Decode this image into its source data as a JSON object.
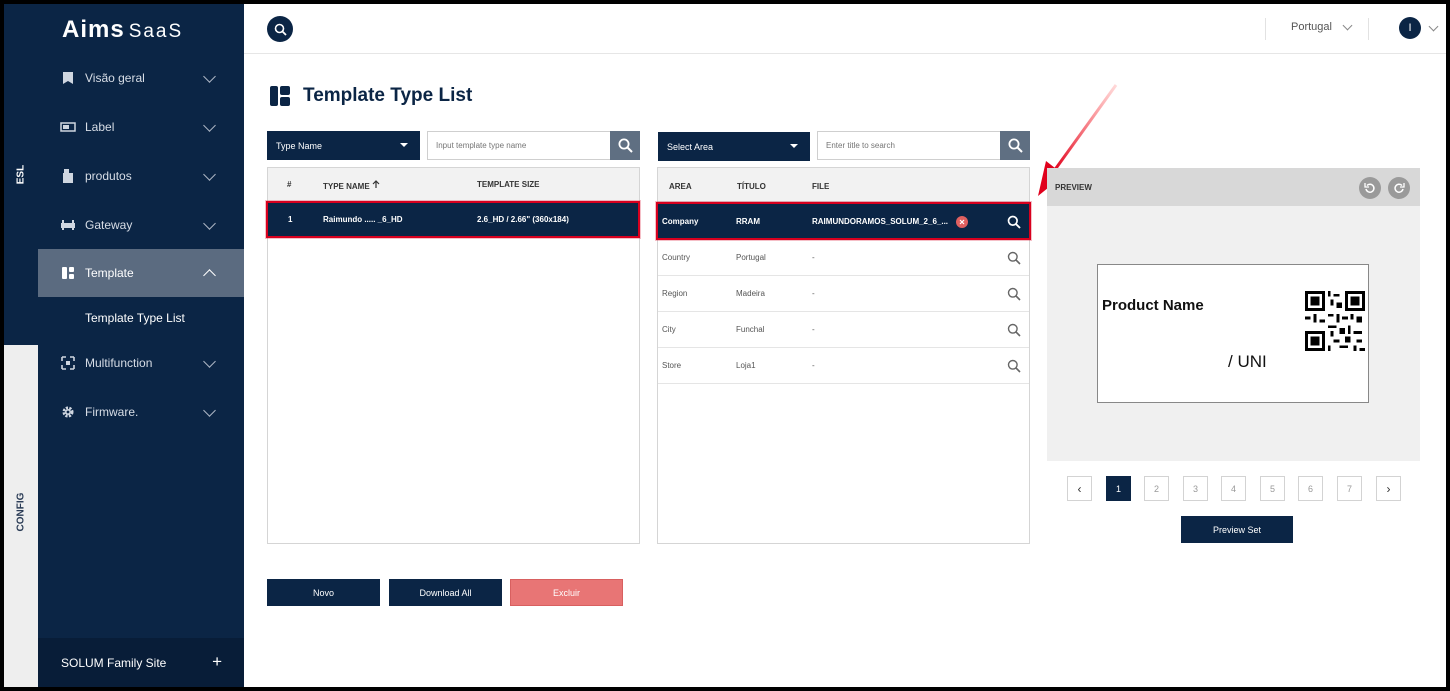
{
  "rail": {
    "esl_label": "ESL",
    "config_label": "CONFIG"
  },
  "app": {
    "logo_main": "Aims",
    "logo_sub": "SaaS"
  },
  "sidebar": {
    "items": [
      {
        "label": "Visão geral"
      },
      {
        "label": "Label"
      },
      {
        "label": "produtos"
      },
      {
        "label": "Gateway"
      },
      {
        "label": "Template"
      },
      {
        "label": "Multifunction"
      },
      {
        "label": "Firmware."
      }
    ],
    "active_sub_item": "Template Type List",
    "footer_label": "SOLUM Family Site",
    "footer_plus": "+"
  },
  "topbar": {
    "language": "Portugal",
    "user_initial": "I"
  },
  "page": {
    "title": "Template Type List"
  },
  "type_filter": {
    "select_label": "Type Name",
    "input_placeholder": "Input template type name"
  },
  "area_filter": {
    "select_label": "Select Area",
    "input_placeholder": "Enter title to search"
  },
  "type_table": {
    "columns": [
      "#",
      "TYPE NAME",
      "TEMPLATE SIZE"
    ],
    "rows": [
      {
        "index": "1",
        "type_name": "Raimundo ..... _6_HD",
        "template_size": "2.6_HD / 2.66\" (360x184)",
        "selected": true
      }
    ]
  },
  "area_table": {
    "columns": [
      "AREA",
      "TÍTULO",
      "FILE"
    ],
    "rows": [
      {
        "area": "Company",
        "title": "RRAM",
        "file": "RAIMUNDORAMOS_SOLUM_2_6_...",
        "selected": true
      },
      {
        "area": "Country",
        "title": "Portugal",
        "file": "-",
        "selected": false
      },
      {
        "area": "Region",
        "title": "Madeira",
        "file": "-",
        "selected": false
      },
      {
        "area": "City",
        "title": "Funchal",
        "file": "-",
        "selected": false
      },
      {
        "area": "Store",
        "title": "Loja1",
        "file": "-",
        "selected": false
      }
    ]
  },
  "preview": {
    "title": "PREVIEW",
    "product_name": "Product Name",
    "price_unit": "/ UNI"
  },
  "pagination": {
    "pages": [
      "1",
      "2",
      "3",
      "4",
      "5",
      "6",
      "7"
    ],
    "current": "1",
    "prev": "‹",
    "next": "›"
  },
  "preview_set_label": "Preview Set",
  "actions": {
    "new_label": "Novo",
    "download_label": "Download All",
    "delete_label": "Excluir"
  },
  "colors": {
    "navy": "#0b2545",
    "sidebar_active": "#5b6b80",
    "delete_red": "#e87575",
    "highlight_red": "#d8001e"
  }
}
